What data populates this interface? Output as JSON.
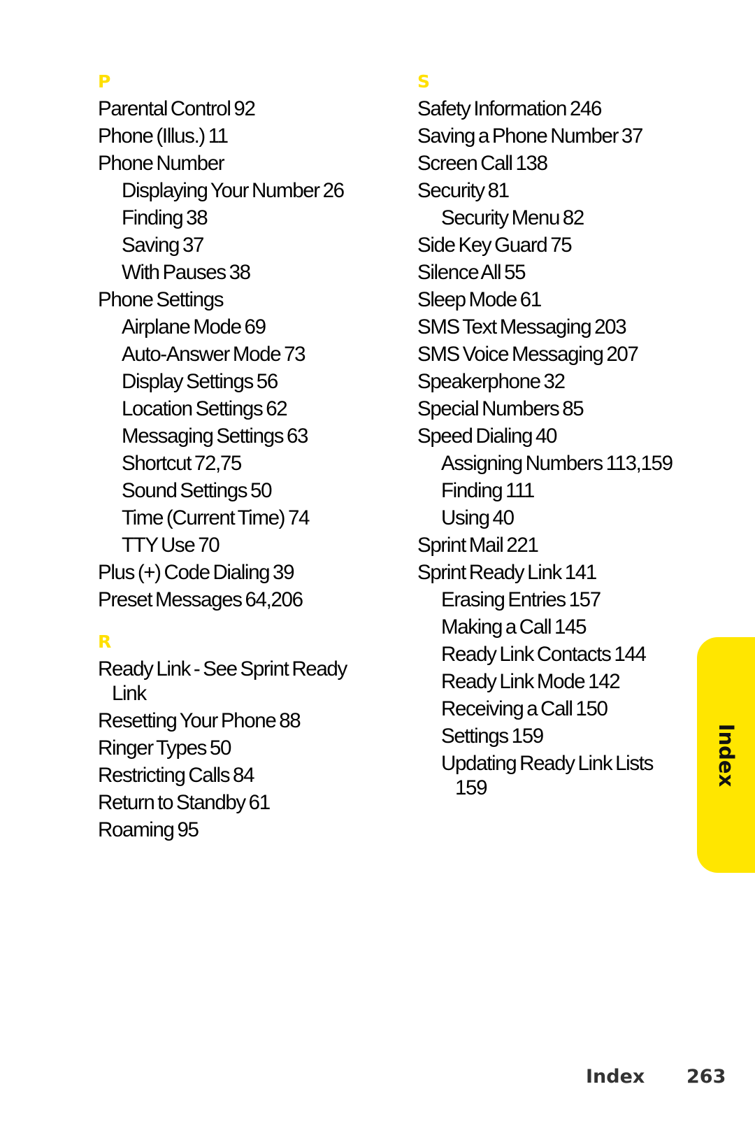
{
  "side_tab": {
    "label": "Index",
    "color": "#FFE600"
  },
  "accent_color": "#FFE000",
  "footer": {
    "section": "Index",
    "page_number": "263"
  },
  "columns": [
    {
      "sections": [
        {
          "letter": "P",
          "entries": [
            {
              "level": 0,
              "text": "Parental Control 92"
            },
            {
              "level": 0,
              "text": "Phone (Illus.) 11"
            },
            {
              "level": 0,
              "text": "Phone Number"
            },
            {
              "level": 1,
              "text": "Displaying Your Number 26"
            },
            {
              "level": 1,
              "text": "Finding 38"
            },
            {
              "level": 1,
              "text": "Saving 37"
            },
            {
              "level": 1,
              "text": "With Pauses 38"
            },
            {
              "level": 0,
              "text": "Phone Settings"
            },
            {
              "level": 1,
              "text": "Airplane Mode 69"
            },
            {
              "level": 1,
              "text": "Auto-Answer Mode 73"
            },
            {
              "level": 1,
              "text": "Display Settings 56"
            },
            {
              "level": 1,
              "text": "Location Settings 62"
            },
            {
              "level": 1,
              "text": "Messaging Settings 63"
            },
            {
              "level": 1,
              "text": "Shortcut 72,75"
            },
            {
              "level": 1,
              "text": "Sound Settings 50"
            },
            {
              "level": 1,
              "text": "Time (Current Time) 74"
            },
            {
              "level": 1,
              "text": "TTY Use 70"
            },
            {
              "level": 0,
              "text": "Plus (+) Code Dialing 39"
            },
            {
              "level": 0,
              "text": "Preset Messages 64,206"
            }
          ]
        },
        {
          "letter": "R",
          "entries": [
            {
              "level": 0,
              "text": "Ready Link - See Sprint Ready Link"
            },
            {
              "level": 0,
              "text": "Resetting Your Phone 88"
            },
            {
              "level": 0,
              "text": "Ringer Types 50"
            },
            {
              "level": 0,
              "text": "Restricting Calls 84"
            },
            {
              "level": 0,
              "text": "Return to Standby 61"
            },
            {
              "level": 0,
              "text": "Roaming 95"
            }
          ]
        }
      ]
    },
    {
      "sections": [
        {
          "letter": "S",
          "entries": [
            {
              "level": 0,
              "text": "Safety Information 246"
            },
            {
              "level": 0,
              "text": "Saving a Phone Number 37"
            },
            {
              "level": 0,
              "text": "Screen Call 138"
            },
            {
              "level": 0,
              "text": "Security 81"
            },
            {
              "level": 1,
              "text": "Security Menu 82"
            },
            {
              "level": 0,
              "text": "Side Key Guard 75"
            },
            {
              "level": 0,
              "text": "Silence All 55"
            },
            {
              "level": 0,
              "text": "Sleep Mode 61"
            },
            {
              "level": 0,
              "text": "SMS Text Messaging 203"
            },
            {
              "level": 0,
              "text": "SMS Voice Messaging 207"
            },
            {
              "level": 0,
              "text": "Speakerphone 32"
            },
            {
              "level": 0,
              "text": "Special Numbers 85"
            },
            {
              "level": 0,
              "text": "Speed Dialing 40"
            },
            {
              "level": 1,
              "text": "Assigning Numbers 113,159"
            },
            {
              "level": 1,
              "text": "Finding 111"
            },
            {
              "level": 1,
              "text": "Using 40"
            },
            {
              "level": 0,
              "text": "Sprint Mail 221"
            },
            {
              "level": 0,
              "text": "Sprint Ready Link 141"
            },
            {
              "level": 1,
              "text": "Erasing Entries 157"
            },
            {
              "level": 1,
              "text": "Making a Call 145"
            },
            {
              "level": 1,
              "text": "Ready Link Contacts 144"
            },
            {
              "level": 1,
              "text": "Ready Link Mode 142"
            },
            {
              "level": 1,
              "text": "Receiving a Call 150"
            },
            {
              "level": 1,
              "text": "Settings 159"
            },
            {
              "level": 1,
              "text": "Updating Ready Link Lists 159"
            }
          ]
        }
      ]
    }
  ]
}
